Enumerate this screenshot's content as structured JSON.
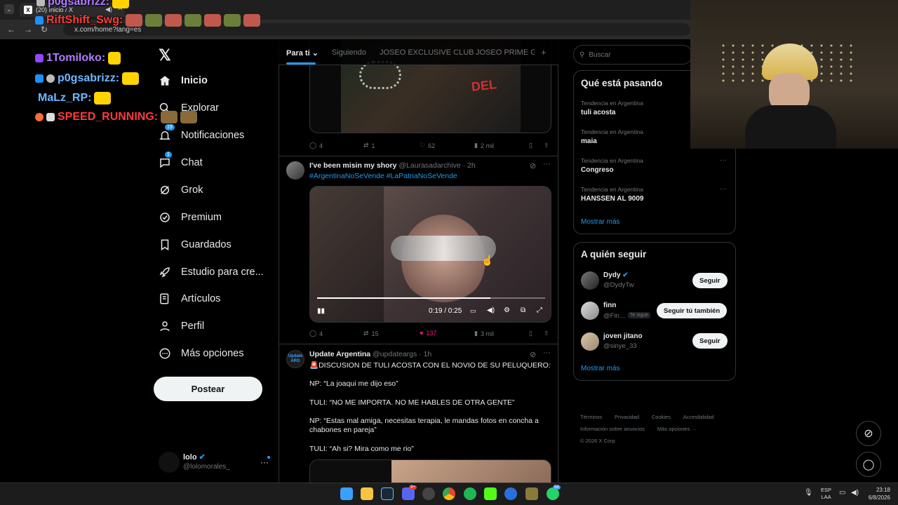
{
  "browser": {
    "tab_title": "(20) Inicio / X",
    "url": "x.com/home?lang=es"
  },
  "stream_chat": [
    {
      "user": "p0gsabrizz:"
    },
    {
      "user": "RiftShift_Swg:"
    },
    {
      "user": "1Tomiloko:"
    },
    {
      "user": "p0gsabrizz:"
    },
    {
      "user": "MaLz_RP:"
    },
    {
      "user": "SPEED_RUNNING:"
    }
  ],
  "colors": {
    "accent": "#1d9bf0",
    "like": "#f91880",
    "chat_purple": "#b27cff",
    "chat_red": "#ff3b3b",
    "chat_yellow": "#ffe14d",
    "chat_blue": "#6fb6ff"
  },
  "nav": {
    "items": [
      {
        "label": "Inicio",
        "icon": "home-icon"
      },
      {
        "label": "Explorar",
        "icon": "search-icon"
      },
      {
        "label": "Notificaciones",
        "icon": "bell-icon",
        "badge": "19"
      },
      {
        "label": "Chat",
        "icon": "chat-icon",
        "badge": "1"
      },
      {
        "label": "Grok",
        "icon": "grok-icon"
      },
      {
        "label": "Premium",
        "icon": "premium-icon"
      },
      {
        "label": "Guardados",
        "icon": "bookmark-icon"
      },
      {
        "label": "Estudio para cre...",
        "icon": "rocket-icon"
      },
      {
        "label": "Artículos",
        "icon": "article-icon"
      },
      {
        "label": "Perfil",
        "icon": "person-icon"
      },
      {
        "label": "Más opciones",
        "icon": "more-circle-icon"
      }
    ],
    "post_label": "Postear",
    "account_name": "lolo",
    "account_handle": "@lolomorales_"
  },
  "timeline": {
    "tabs": [
      "Para ti",
      "Siguiendo",
      "JOSEO EXCLUSIVE CLUB",
      "JOSEO PRIME GR",
      "+"
    ],
    "tweet1_actions": {
      "replies": "4",
      "retweets": "1",
      "likes": "62",
      "views": "2 mil"
    },
    "tweet2": {
      "name": "I've been misin my shory",
      "handle": "@Laurasadarchive",
      "time": "· 2h",
      "hashtags": "#ArgentinaNoSeVende #LaPatriaNoSeVende",
      "video_time": "0:19 / 0:25",
      "progress": 0.76,
      "replies": "4",
      "retweets": "15",
      "likes": "137",
      "views": "3 mil"
    },
    "tweet3": {
      "name": "Update Argentina",
      "handle": "@updateargs",
      "time": "· 1h",
      "avatar_text": "Update ARG",
      "lines": [
        "🚨DISCUSION DE TULI ACOSTA CON EL NOVIO DE SU PELUQUERO:",
        "NP: “La joaqui me dijo eso”",
        "TULI: “NO ME IMPORTA. NO ME HABLES DE OTRA GENTE”",
        "NP: “Estas mal amiga, necesitas terapia, le mandas fotos en concha a chabones en pareja”",
        "TULI: “Ah si? Mira como me rio”"
      ]
    }
  },
  "sidebar": {
    "search_placeholder": "Buscar",
    "trends_title": "Qué está pasando",
    "trends": [
      {
        "category": "Tendencia en Argentina",
        "name": "tuli acosta"
      },
      {
        "category": "Tendencia en Argentina",
        "name": "maia"
      },
      {
        "category": "Tendencia en Argentina",
        "name": "Congreso"
      },
      {
        "category": "Tendencia en Argentina",
        "name": "HANSSEN AL 9009"
      }
    ],
    "show_more": "Mostrar más",
    "who_title": "A quién seguir",
    "who": [
      {
        "name": "Dydy",
        "handle": "@DydyTw",
        "button": "Seguir",
        "follows_you": ""
      },
      {
        "name": "finn",
        "handle": "@Fin...",
        "button": "Seguir tú también",
        "follows_you": "Te sigue"
      },
      {
        "name": "joven jitano",
        "handle": "@sinye_33",
        "button": "Seguir",
        "follows_you": ""
      }
    ],
    "footer": [
      "Términos",
      "Privacidad",
      "Cookies",
      "Accesibilidad",
      "Información sobre anuncios",
      "Más opciones ···",
      "© 2026 X Corp."
    ]
  },
  "taskbar": {
    "lang_top": "ESP",
    "lang_bottom": "LAA",
    "time": "23:18",
    "date": "6/8/2026",
    "discord_badge": "9+",
    "whatsapp_badge": "59"
  }
}
